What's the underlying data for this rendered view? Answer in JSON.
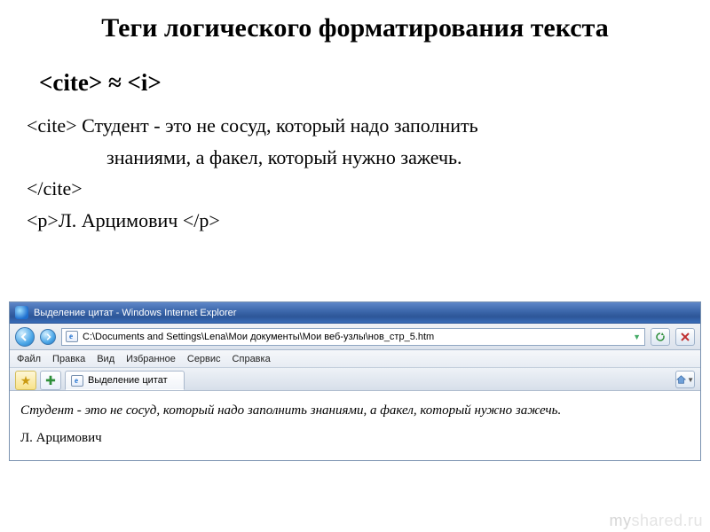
{
  "slide": {
    "title": "Теги логического форматирования текста",
    "subtitle": "<cite>  ≈  <i>",
    "code": {
      "open": "<cite>",
      "line1_after_open": " Студент - это не сосуд, который надо заполнить",
      "line2": "знаниями, а факел, который нужно зажечь.",
      "close": "</cite>",
      "p_open": "<p>",
      "author": "Л. Арцимович   ",
      "p_close": "</p>"
    }
  },
  "browser": {
    "window_title": "Выделение цитат - Windows Internet Explorer",
    "address": "C:\\Documents and Settings\\Lena\\Мои документы\\Мои веб-узлы\\нов_стр_5.htm",
    "menu": [
      "Файл",
      "Правка",
      "Вид",
      "Избранное",
      "Сервис",
      "Справка"
    ],
    "tab_label": "Выделение цитат",
    "page": {
      "cite_text": "Студент - это не сосуд, который надо заполнить знаниями, а факел, который нужно зажечь.",
      "author": "Л. Арцимович"
    }
  },
  "watermark": {
    "left": "my",
    "right": "shared.ru"
  }
}
